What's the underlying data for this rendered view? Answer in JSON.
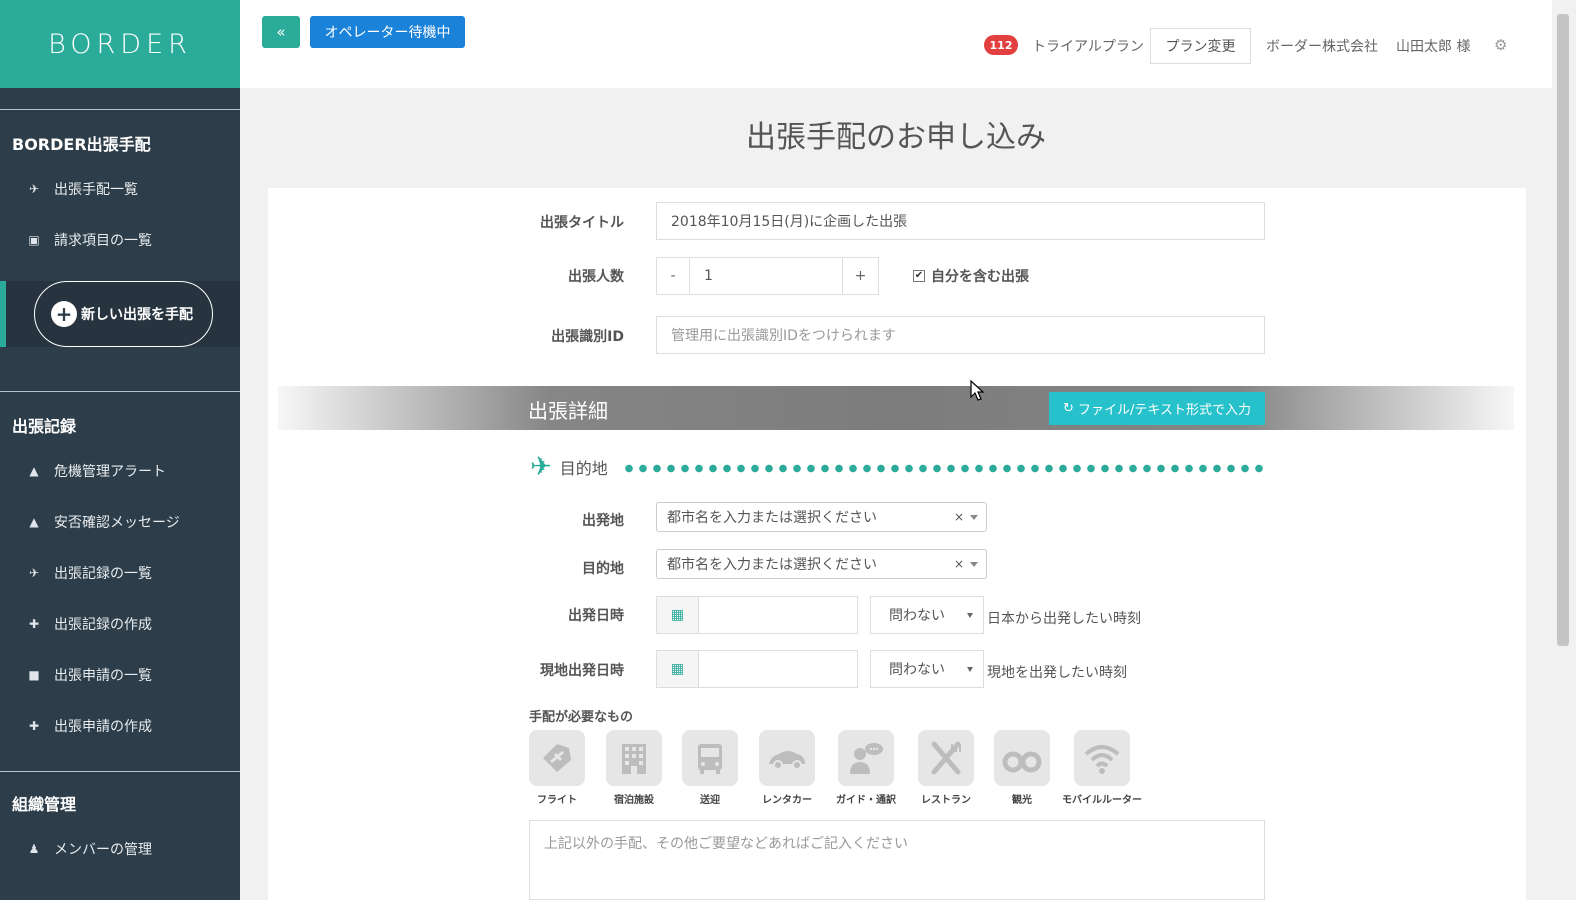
{
  "sidebar": {
    "logo": "BORDER",
    "section1": "BORDER出張手配",
    "items1": [
      {
        "icon": "plane-icon",
        "glyph": "✈",
        "label": "出張手配一覧"
      },
      {
        "icon": "money-icon",
        "glyph": "▣",
        "label": "請求項目の一覧"
      }
    ],
    "new_trip": "新しい出張を手配",
    "section2": "出張記録",
    "items2": [
      {
        "icon": "warning-icon",
        "glyph": "▲",
        "label": "危機管理アラート"
      },
      {
        "icon": "warning-icon",
        "glyph": "▲",
        "label": "安否確認メッセージ"
      },
      {
        "icon": "plane-icon",
        "glyph": "✈",
        "label": "出張記録の一覧"
      },
      {
        "icon": "plus-icon",
        "glyph": "✚",
        "label": "出張記録の作成"
      },
      {
        "icon": "briefcase-icon",
        "glyph": "■",
        "label": "出張申請の一覧"
      },
      {
        "icon": "plus-icon",
        "glyph": "✚",
        "label": "出張申請の作成"
      }
    ],
    "section3": "組織管理",
    "items3": [
      {
        "icon": "users-icon",
        "glyph": "♟",
        "label": "メンバーの管理"
      }
    ]
  },
  "topbar": {
    "collapse_glyph": "«",
    "operator_label": "オペレーター待機中",
    "badge_count": "112",
    "plan_label": "トライアルプラン",
    "plan_change": "プラン変更",
    "company": "ボーダー株式会社",
    "user": "山田太郎 様",
    "gear_glyph": "⚙"
  },
  "main": {
    "title": "出張手配のお申し込み",
    "trip_title_label": "出張タイトル",
    "trip_title_value": "2018年10月15日(月)に企画した出張",
    "people_label": "出張人数",
    "people_value": "1",
    "minus": "-",
    "plus": "+",
    "include_self_label": "自分を含む出張",
    "include_self_checked": true,
    "trip_id_label": "出張識別ID",
    "trip_id_placeholder": "管理用に出張識別IDをつけられます",
    "detail_title": "出張詳細",
    "file_button": "ファイル/テキスト形式で入力",
    "destination_heading": "目的地",
    "departure_label": "出発地",
    "departure_placeholder": "都市名を入力または選択ください",
    "destination_label": "目的地",
    "destination_placeholder": "都市名を入力または選択ください",
    "clear_glyph": "×",
    "depart_dt_label": "出発日時",
    "depart_time_value": "問わない",
    "depart_hint": "日本から出発したい時刻",
    "local_dt_label": "現地出発日時",
    "local_time_value": "問わない",
    "local_hint": "現地を出発したい時刻",
    "needs_label": "手配が必要なもの",
    "services": [
      {
        "icon": "flight-icon",
        "label": "フライト"
      },
      {
        "icon": "hotel-icon",
        "label": "宿泊施設"
      },
      {
        "icon": "transfer-icon",
        "label": "送迎"
      },
      {
        "icon": "rental-car-icon",
        "label": "レンタカー"
      },
      {
        "icon": "guide-icon",
        "label": "ガイド・通訳"
      },
      {
        "icon": "restaurant-icon",
        "label": "レストラン"
      },
      {
        "icon": "sightseeing-icon",
        "label": "観光"
      },
      {
        "icon": "wifi-icon",
        "label": "モバイルルーター"
      }
    ],
    "notes_placeholder": "上記以外の手配、その他ご要望などあればご記入ください"
  }
}
